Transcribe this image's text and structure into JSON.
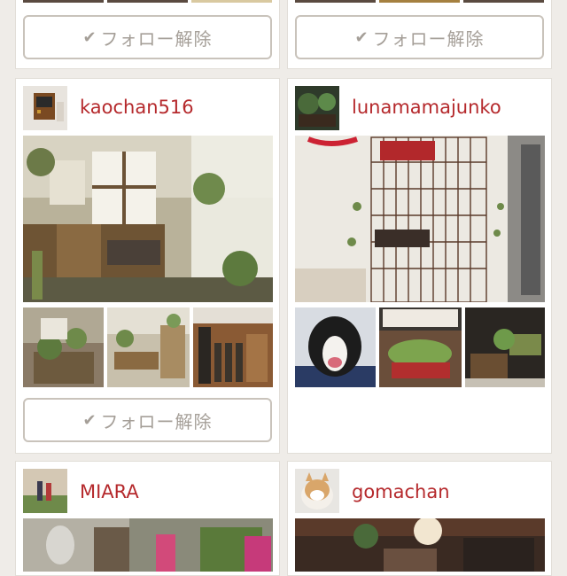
{
  "cards": {
    "top_left": {
      "button_label": "フォロー解除"
    },
    "top_right": {
      "button_label": "フォロー解除"
    },
    "kaochan": {
      "username": "kaochan516",
      "button_label": "フォロー解除"
    },
    "luna": {
      "username": "lunamamajunko"
    },
    "miara": {
      "username": "MIARA"
    },
    "gomachan": {
      "username": "gomachan"
    }
  },
  "icons": {
    "check": "check-icon"
  },
  "colors": {
    "username": "#b5292c",
    "button_text": "#a59f98",
    "button_border": "#c9c3bb",
    "background": "#efece8"
  }
}
